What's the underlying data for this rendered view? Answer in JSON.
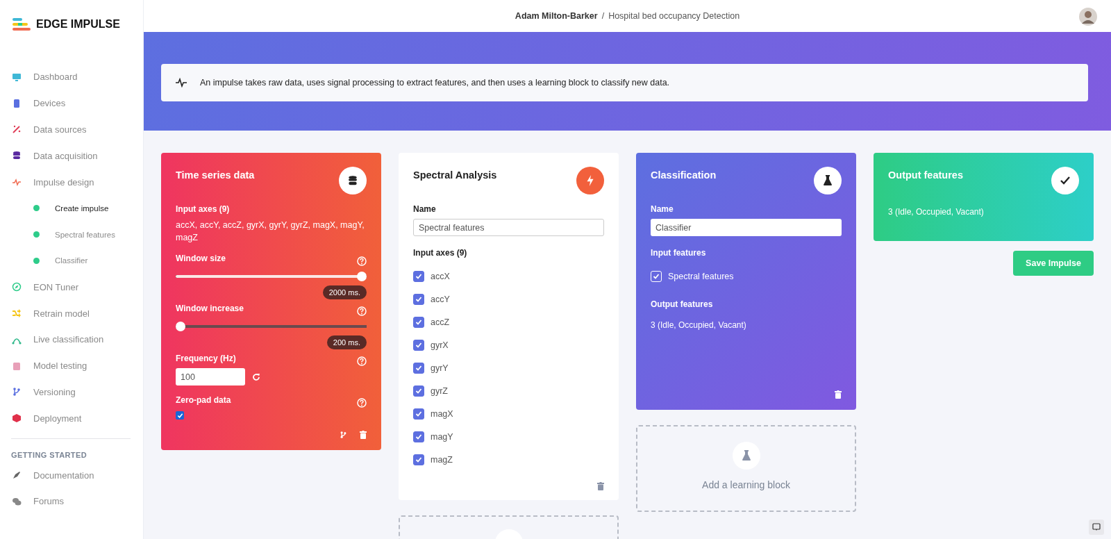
{
  "logo": {
    "text": "EDGE IMPULSE"
  },
  "header": {
    "user": "Adam Milton-Barker",
    "separator": "/",
    "project": "Hospital bed occupancy Detection"
  },
  "sidebar": {
    "items": [
      {
        "label": "Dashboard",
        "color": "#3fb8d6",
        "selected": false
      },
      {
        "label": "Devices",
        "color": "#5a6fe0",
        "selected": false
      },
      {
        "label": "Data sources",
        "color": "#e0405a",
        "selected": false
      },
      {
        "label": "Data acquisition",
        "color": "#5a2aa0",
        "selected": false
      },
      {
        "label": "Impulse design",
        "color": "#f06a50",
        "selected": false,
        "children": [
          {
            "label": "Create impulse",
            "color": "#2ecc8a",
            "selected": true
          },
          {
            "label": "Spectral features",
            "color": "#2ecc8a",
            "selected": false
          },
          {
            "label": "Classifier",
            "color": "#2ecc8a",
            "selected": false
          }
        ]
      },
      {
        "label": "EON Tuner",
        "color": "#2ecc8a",
        "selected": false
      },
      {
        "label": "Retrain model",
        "color": "#f5c518",
        "selected": false
      },
      {
        "label": "Live classification",
        "color": "#2eb88a",
        "selected": false
      },
      {
        "label": "Model testing",
        "color": "#e8a0b8",
        "selected": false
      },
      {
        "label": "Versioning",
        "color": "#5a6fe0",
        "selected": false
      },
      {
        "label": "Deployment",
        "color": "#e0304a",
        "selected": false
      }
    ],
    "section": "GETTING STARTED",
    "links": [
      {
        "label": "Documentation",
        "color": "#666666"
      },
      {
        "label": "Forums",
        "color": "#888888"
      }
    ]
  },
  "banner": {
    "text": "An impulse takes raw data, uses signal processing to extract features, and then uses a learning block to classify new data."
  },
  "blocks": [
    {
      "kind": "input",
      "title": "Time series data",
      "axes_label": "Input axes (9)",
      "axes": "accX, accY, accZ, gyrX, gyrY, gyrZ, magX, magY, magZ",
      "sliders": [
        {
          "label": "Window size",
          "level": 1,
          "reading": "2000 ms."
        },
        {
          "label": "Window increase",
          "level": 0,
          "reading": "200 ms."
        }
      ],
      "frequency": {
        "label": "Frequency (Hz)",
        "value": "100"
      },
      "zero_pad": {
        "label": "Zero-pad data",
        "checked": true
      }
    },
    {
      "kind": "processing",
      "title": "Spectral Analysis",
      "name_label": "Name",
      "name": "Spectral features",
      "axes_label": "Input axes (9)",
      "axes": [
        {
          "label": "accX",
          "checked": true
        },
        {
          "label": "accY",
          "checked": true
        },
        {
          "label": "accZ",
          "checked": true
        },
        {
          "label": "gyrX",
          "checked": true
        },
        {
          "label": "gyrY",
          "checked": true
        },
        {
          "label": "gyrZ",
          "checked": true
        },
        {
          "label": "magX",
          "checked": true
        },
        {
          "label": "magY",
          "checked": true
        },
        {
          "label": "magZ",
          "checked": true
        }
      ]
    },
    {
      "kind": "learning",
      "title": "Classification",
      "name_label": "Name",
      "name": "Classifier",
      "inputs_label": "Input features",
      "inputs": [
        {
          "label": "Spectral features",
          "checked": true
        }
      ],
      "output_label": "Output features",
      "output": "3 (Idle, Occupied, Vacant)"
    },
    {
      "kind": "output",
      "title": "Output features",
      "output": "3 (Idle, Occupied, Vacant)"
    }
  ],
  "add_learning_block": "Add a learning block",
  "save_button": "Save Impulse"
}
